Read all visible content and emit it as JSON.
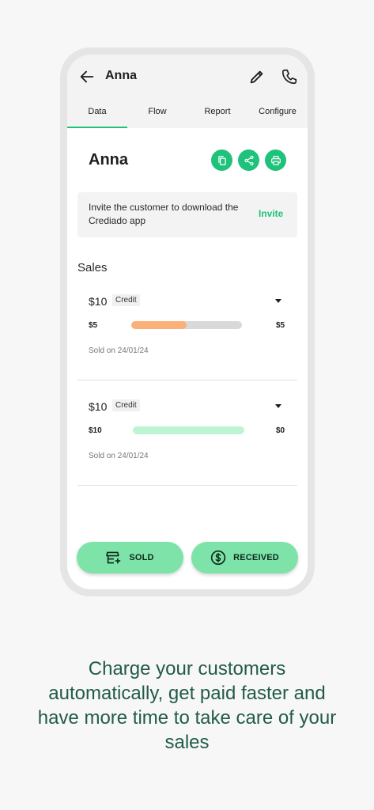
{
  "header": {
    "title": "Anna",
    "icons": {
      "back": "arrow-left-icon",
      "edit": "pencil-icon",
      "call": "phone-icon"
    }
  },
  "tabs": [
    {
      "label": "Data",
      "active": true
    },
    {
      "label": "Flow",
      "active": false
    },
    {
      "label": "Report",
      "active": false
    },
    {
      "label": "Configure",
      "active": false
    }
  ],
  "customer": {
    "name": "Anna",
    "actions": [
      "copy-icon",
      "share-icon",
      "print-icon"
    ]
  },
  "invite": {
    "message": "Invite the customer to download the Crediado app",
    "link_label": "Invite"
  },
  "sales": {
    "title": "Sales",
    "items": [
      {
        "amount": "$10",
        "type": "Credit",
        "paid": "$5",
        "remaining": "$5",
        "progress": 0.5,
        "bar_color": "#fbb077",
        "sold_on": "Sold on 24/01/24"
      },
      {
        "amount": "$10",
        "type": "Credit",
        "paid": "$10",
        "remaining": "$0",
        "progress": 1.0,
        "bar_color": "#bdf5d3",
        "sold_on": "Sold on 24/01/24"
      }
    ]
  },
  "buttons": {
    "sold_label": "SOLD",
    "received_label": "RECEIVED"
  },
  "tagline": "Charge your customers automatically, get paid faster and have more time to take care of your sales",
  "colors": {
    "accent": "#1fc27a",
    "button_bg": "#7ee3a9",
    "tagline": "#225c45"
  }
}
